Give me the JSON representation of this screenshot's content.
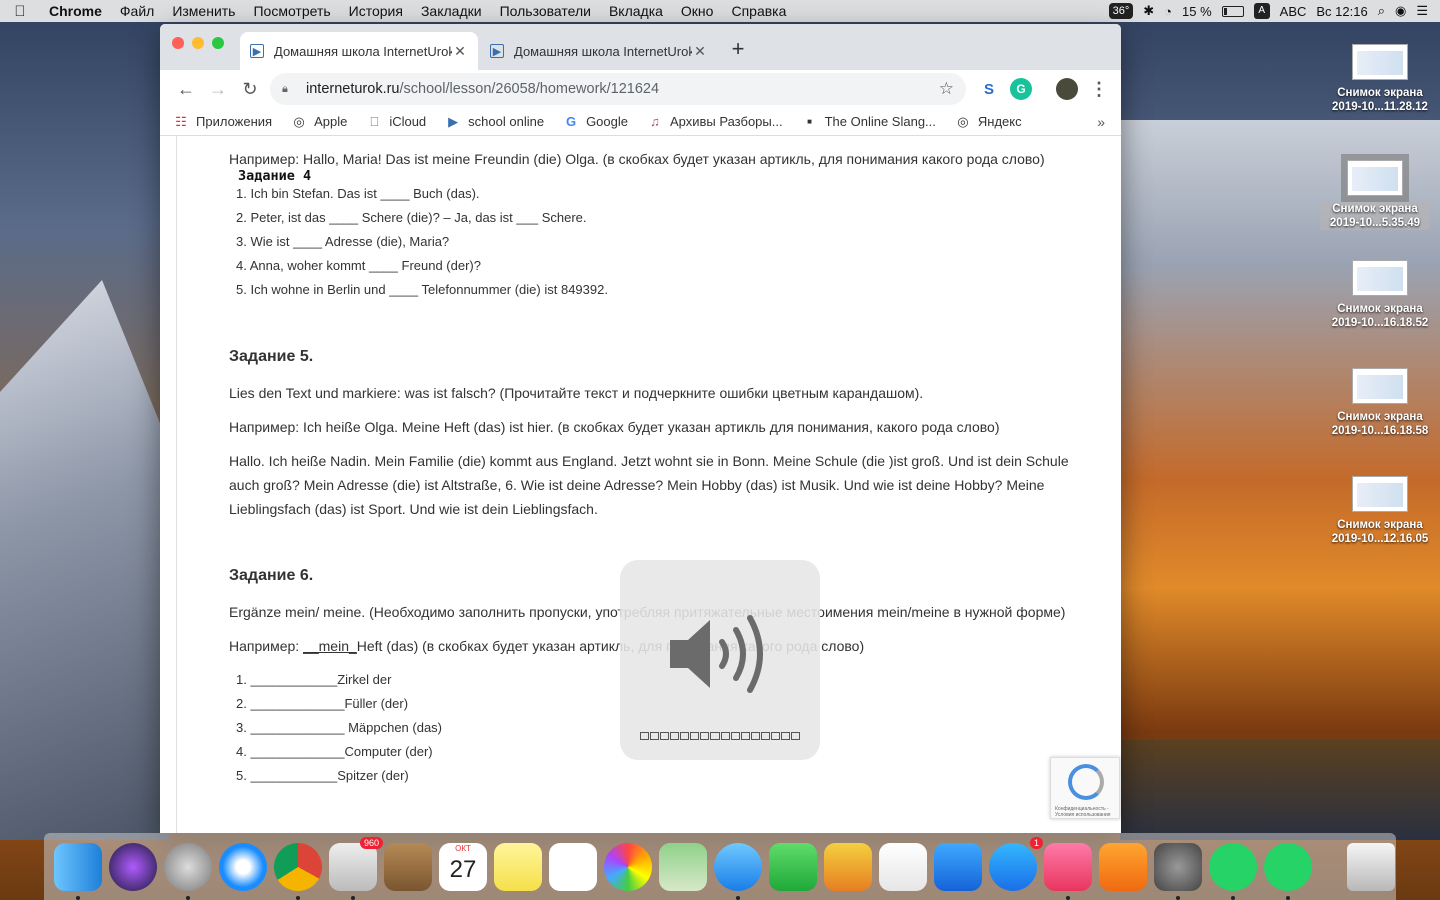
{
  "menubar": {
    "app": "Chrome",
    "items": [
      "Файл",
      "Изменить",
      "Посмотреть",
      "История",
      "Закладки",
      "Пользователи",
      "Вкладка",
      "Окно",
      "Справка"
    ],
    "temp": "36°",
    "battery": "15 %",
    "kb_letter": "A",
    "kb_layout": "ABC",
    "clock": "Вс 12:16"
  },
  "browser": {
    "tabs": [
      {
        "title": "Домашняя школа InternetUrok"
      },
      {
        "title": "Домашняя школа InternetUrok"
      }
    ],
    "url_host": "interneturok.ru",
    "url_path": "/school/lesson/26058/homework/121624",
    "bookmarks": [
      "Приложения",
      "Apple",
      "iCloud",
      "school online",
      "Google",
      "Архивы Разборы...",
      "The Online Slang...",
      "Яндекс"
    ],
    "more": "»"
  },
  "page": {
    "example_top": "Например:  Hallo, Maria! Das ist meine Freundin (die) Olga. (в скобках будет указан артикль, для понимания какого рода слово)",
    "task4_title": "Задание  4",
    "task4_items": [
      "Ich bin Stefan. Das ist ____ Buch (das).",
      "Peter, ist das ____ Schere (die)? – Ja, das ist ___ Schere.",
      "Wie ist ____ Adresse (die), Maria?",
      "Anna, woher kommt ____ Freund (der)?",
      "Ich wohne in Berlin und ____ Telefonnummer (die) ist  849392."
    ],
    "task5_title": "Задание 5.",
    "task5_instruction": "Lies den Text und markiere: was ist falsch? (Прочитайте текст и подчеркните ошибки цветным карандашом).",
    "task5_example": "Например: Ich heiße Olga. Meine Heft (das) ist hier. (в скобках будет указан артикль для понимания, какого рода слово)",
    "task5_text": "Hallo. Ich heiße Nadin. Mein Familie (die) kommt aus England. Jetzt wohnt sie in Bonn.  Meine Schule (die )ist groß. Und  ist dein Schule auch groß? Mein Adresse (die) ist Altstraße, 6.  Wie ist deine Adresse? Mein Hobby (das) ist Musik. Und wie ist deine Hobby?  Meine Lieblingsfach (das) ist Sport.  Und wie ist dein Lieblingsfach.",
    "task6_title": "Задание 6.",
    "task6_instruction": "Ergänze mein/ meine. (Необходимо заполнить пропуски, употребляя притяжательные местоимения mein/meine в нужной форме)",
    "task6_example_prefix": "Например: ",
    "task6_example_word": "__mein_",
    "task6_example_suffix": "Heft (das) (в скобках будет указан артикль, для понимания какого рода слово)",
    "task6_items": [
      "____________Zirkel der",
      "_____________Füller (der)",
      "_____________ Mäppchen (das)",
      "_____________Computer (der)",
      "____________Spitzer (der)"
    ]
  },
  "volume": {
    "level": 0,
    "segments": 16
  },
  "recaptcha": {
    "text": "Конфиденциальность - Условия использования"
  },
  "desktop_icons": [
    {
      "line1": "Снимок экрана",
      "line2": "2019-10...11.28.12"
    },
    {
      "line1": "Снимок экрана",
      "line2": "2019-10...5.35.49"
    },
    {
      "line1": "Снимок экрана",
      "line2": "2019-10...16.18.52"
    },
    {
      "line1": "Снимок экрана",
      "line2": "2019-10...16.18.58"
    },
    {
      "line1": "Снимок экрана",
      "line2": "2019-10...12.16.05"
    }
  ],
  "dock": {
    "mail_badge": "960",
    "appstore_badge": "1",
    "calendar_month": "ОКТ",
    "calendar_day": "27"
  }
}
